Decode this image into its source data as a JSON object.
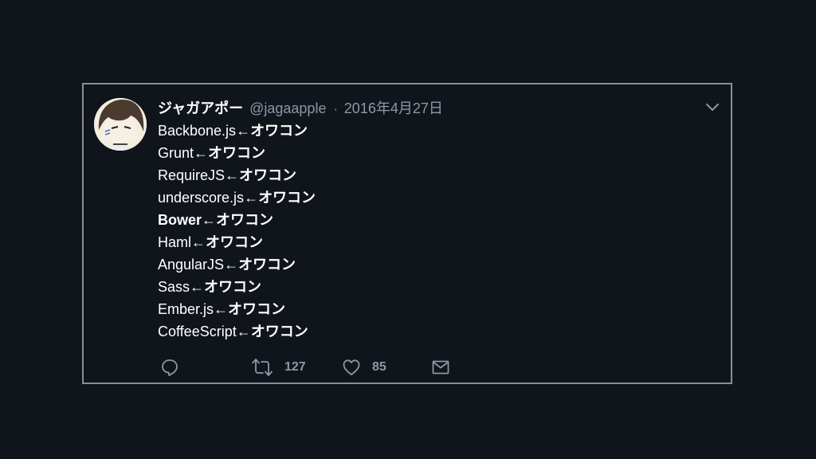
{
  "tweet": {
    "display_name": "ジャガアポー",
    "handle": "@jagaapple",
    "separator": "·",
    "date": "2016年4月27日",
    "lines": [
      {
        "prefix": "Backbone.js",
        "suffix": "←オワコン"
      },
      {
        "prefix": "Grunt",
        "suffix": "←オワコン"
      },
      {
        "prefix": "RequireJS",
        "suffix": "←オワコン"
      },
      {
        "prefix": "underscore.js",
        "suffix": "←オワコン"
      },
      {
        "prefix": "Bower",
        "suffix": "←オワコン"
      },
      {
        "prefix": "Haml",
        "suffix": "←オワコン"
      },
      {
        "prefix": "AngularJS",
        "suffix": "←オワコン"
      },
      {
        "prefix": "Sass",
        "suffix": "←オワコン"
      },
      {
        "prefix": "Ember.js",
        "suffix": "←オワコン"
      },
      {
        "prefix": "CoffeeScript",
        "suffix": "←オワコン"
      }
    ],
    "actions": {
      "reply": {
        "icon": "reply-icon"
      },
      "retweet": {
        "icon": "retweet-icon",
        "count": "127"
      },
      "like": {
        "icon": "heart-icon",
        "count": "85"
      },
      "dm": {
        "icon": "mail-icon"
      }
    }
  },
  "colors": {
    "background": "#10141b",
    "card_border": "#8a8f96",
    "text_primary": "#ffffff",
    "text_secondary": "#8b98a5"
  }
}
